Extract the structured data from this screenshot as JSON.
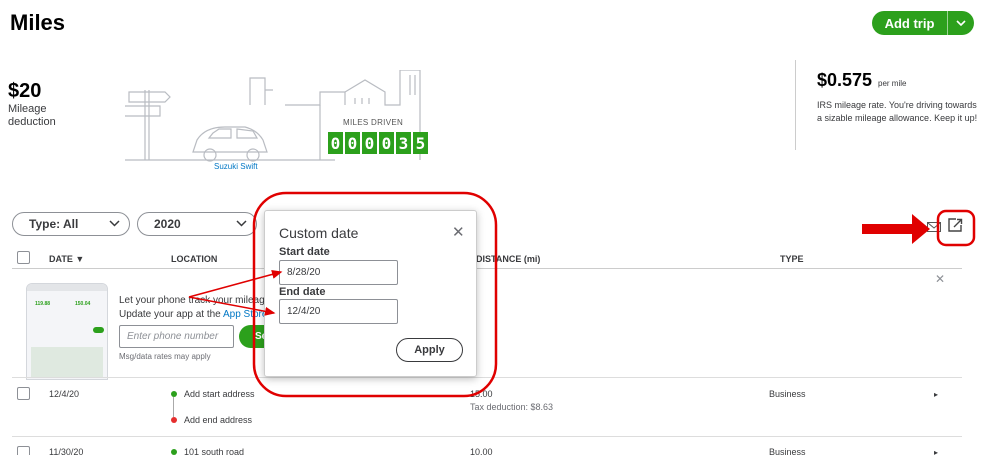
{
  "page": {
    "title": "Miles"
  },
  "actions": {
    "add_trip": "Add trip"
  },
  "summary": {
    "deduction_amount": "$20",
    "deduction_label": "Mileage deduction",
    "miles_driven_label": "MILES DRIVEN",
    "odometer_digits": [
      "0",
      "0",
      "0",
      "0",
      "3",
      "5"
    ],
    "vehicle_name": "Suzuki Swift",
    "rate_amount": "$0.575",
    "rate_unit": "per mile",
    "rate_description": "IRS mileage rate. You're driving towards a sizable mileage allowance. Keep it up!"
  },
  "filters": {
    "type_label": "Type: All",
    "year_label": "2020"
  },
  "table": {
    "headers": {
      "date": "DATE ▼",
      "location": "LOCATION",
      "distance": "DISTANCE (mi)",
      "type": "TYPE"
    },
    "rows": [
      {
        "date": "12/4/20",
        "start": "Add start address",
        "end": "Add end address",
        "distance": "15.00",
        "deduction": "Tax deduction: $8.63",
        "type": "Business"
      },
      {
        "date": "11/30/20",
        "start": "101 south road",
        "distance": "10.00",
        "type": "Business"
      }
    ]
  },
  "promo": {
    "line1": "Let your phone track your mileag",
    "line2_prefix": "Update your app at the ",
    "line2_link": "App Store",
    "phone_placeholder": "Enter phone number",
    "send_label": "Se",
    "disclaimer": "Msg/data rates may apply",
    "mock_value_1": "119.88",
    "mock_value_2": "150.04"
  },
  "custom_date": {
    "title": "Custom date",
    "start_label": "Start date",
    "start_value": "8/28/20",
    "end_label": "End date",
    "end_value": "12/4/20",
    "apply_label": "Apply"
  },
  "colors": {
    "brand_green": "#2ca01c",
    "annotation_red": "#e00000",
    "link_blue": "#0077c5"
  }
}
